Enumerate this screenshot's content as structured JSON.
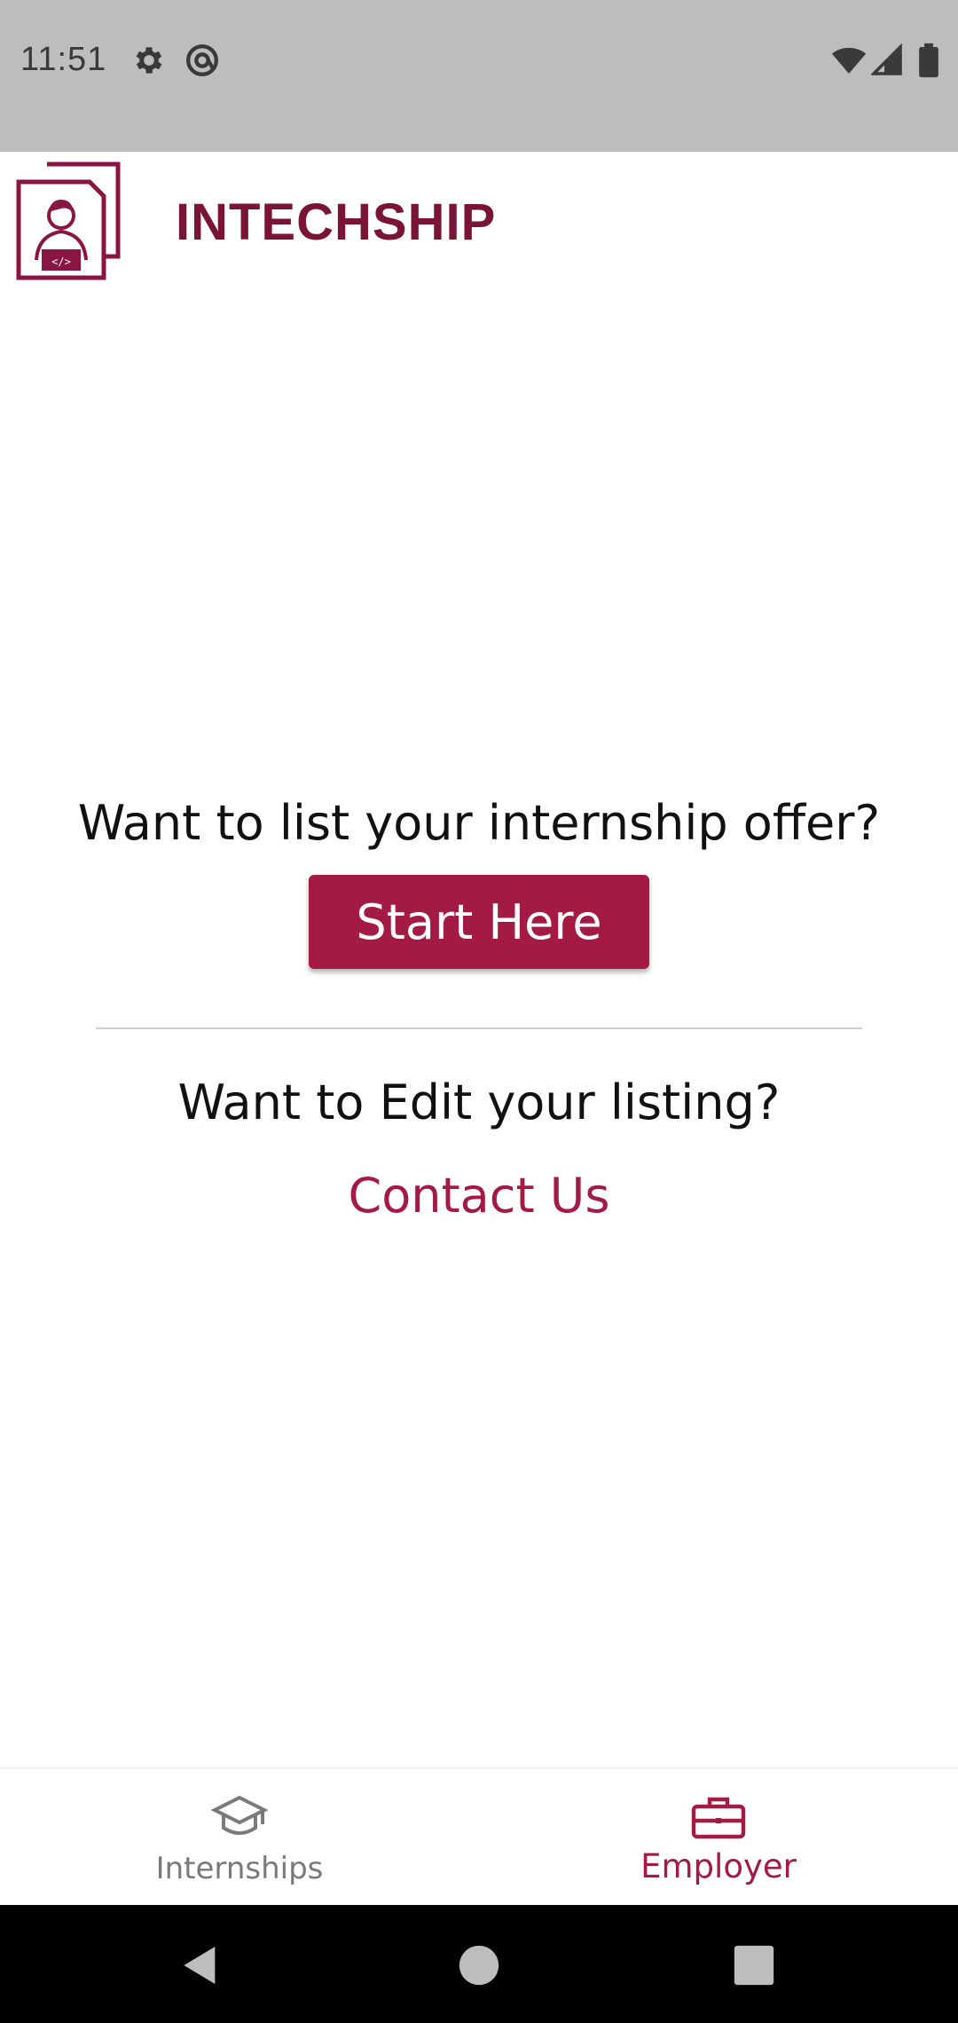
{
  "status_bar": {
    "time": "11:51",
    "icons": [
      "gear-icon",
      "at-sign-icon",
      "wifi-icon",
      "signal-icon",
      "battery-icon"
    ]
  },
  "header": {
    "brand": "INTECHSHIP",
    "logo_icon": "intern-developer-logo"
  },
  "main": {
    "list_question": "Want to list your internship offer?",
    "start_button_label": "Start Here",
    "edit_question": "Want to Edit your listing?",
    "contact_link": "Contact Us"
  },
  "bottom_nav": {
    "items": [
      {
        "label": "Internships",
        "icon": "graduation-cap-icon",
        "active": false
      },
      {
        "label": "Employer",
        "icon": "briefcase-icon",
        "active": true
      }
    ]
  },
  "system_nav": [
    "back-icon",
    "home-icon",
    "recents-icon"
  ],
  "colors": {
    "brand": "#7a1436",
    "accent": "#a31a45",
    "status_bar": "#bdbdbd",
    "inactive_nav": "#7a7a7a"
  }
}
